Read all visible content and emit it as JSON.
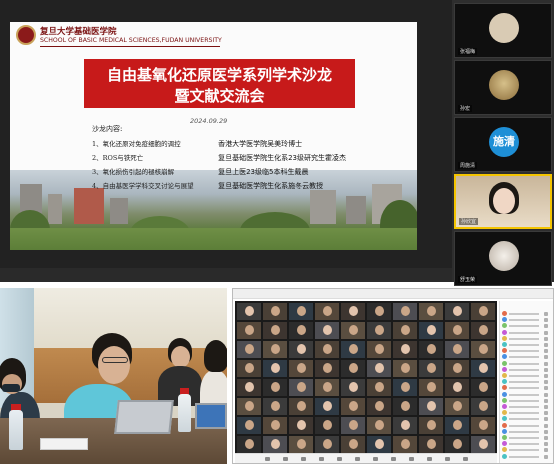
{
  "slide": {
    "university_cn": "复旦大学基础医学院",
    "university_en": "SCHOOL OF BASIC MEDICAL SCIENCES,FUDAN UNIVERSITY",
    "title_line1": "自由基氧化还原医学系列学术沙龙",
    "title_line2": "暨文献交流会",
    "date": "2024.09.29",
    "content_header": "沙龙内容:",
    "agenda": [
      {
        "topic": "1、氧化还原对免疫细胞的调控",
        "speaker": "香港大学医学院吴美玲博士"
      },
      {
        "topic": "2、ROS与铁死亡",
        "speaker": "复旦基础医学院生化系23级研究生霍凌杰"
      },
      {
        "topic": "3、氧化损伤引起的褪核崩解",
        "speaker": "复旦上医23级临5本科生戴晨"
      },
      {
        "topic": "4、自由基医学学科交叉讨论与展望",
        "speaker": "复旦基础医学院生化系施冬云教授"
      }
    ]
  },
  "participants": [
    {
      "name": "张福梅",
      "avatar_text": "",
      "active": false,
      "avatar_color": "#d9cbb4"
    },
    {
      "name": "孙宏",
      "avatar_text": "",
      "active": false,
      "avatar_color": "#b49a63"
    },
    {
      "name": "周施清",
      "avatar_text": "施清",
      "active": false,
      "avatar_color": "#1e8fd6"
    },
    {
      "name": "孙欣宜",
      "avatar_text": "",
      "active": true,
      "avatar_color": "#e4c6b0"
    },
    {
      "name": "舒玉荣",
      "avatar_text": "",
      "active": false,
      "avatar_color": "#d8d2ca"
    }
  ],
  "grid": {
    "title": "",
    "participant_list_header": ""
  }
}
